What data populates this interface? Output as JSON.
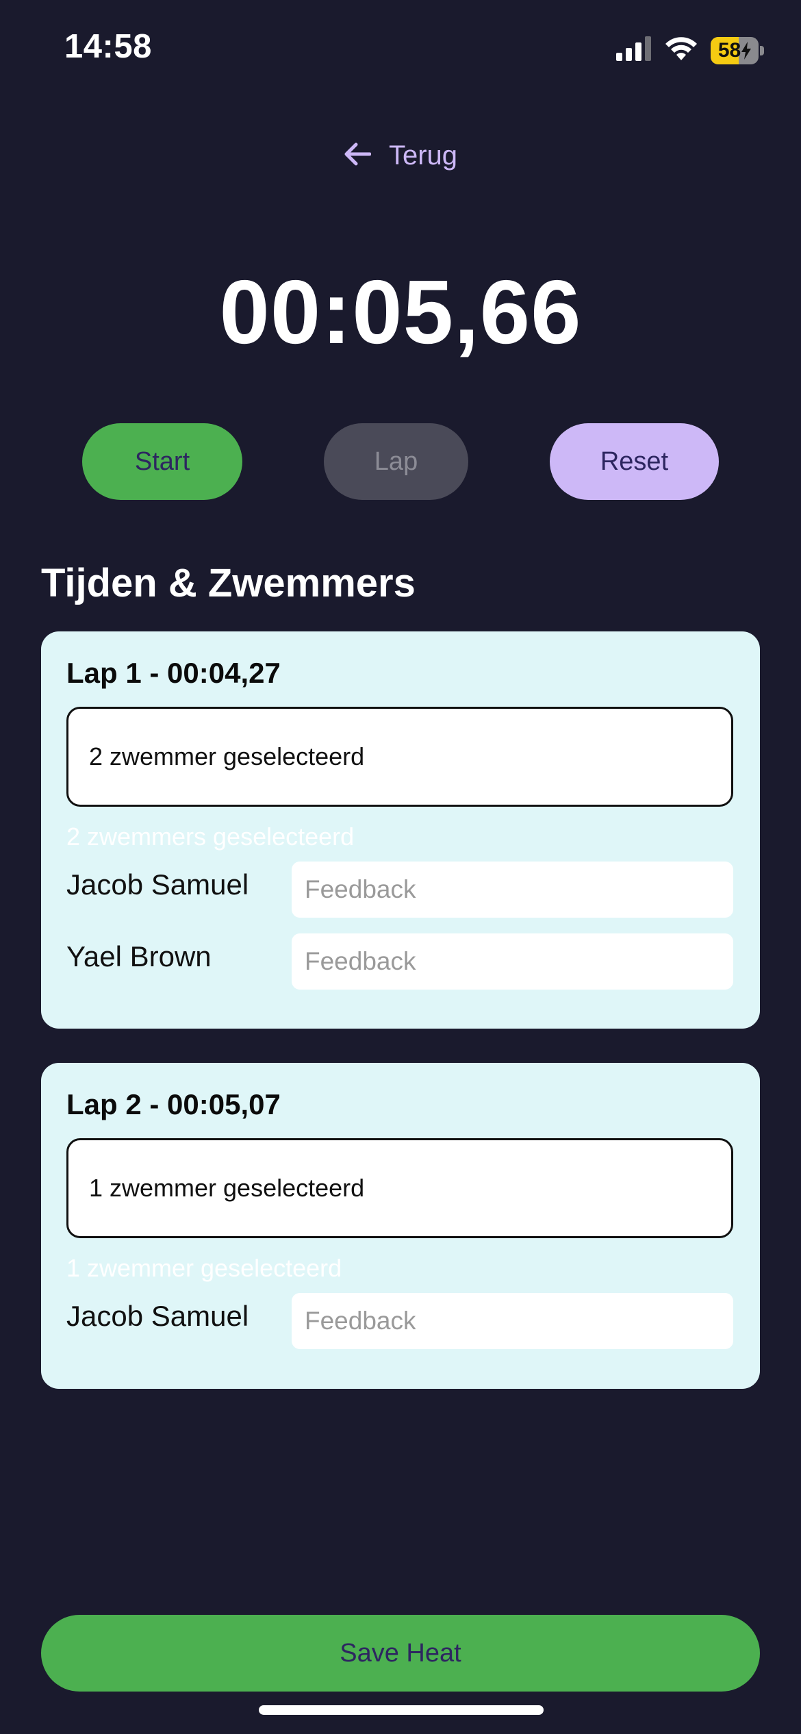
{
  "status_bar": {
    "time": "14:58",
    "battery_level": "58",
    "battery_fraction": 0.58,
    "icons": [
      "cellular-signal-icon",
      "wifi-icon",
      "battery-charging-icon"
    ]
  },
  "nav": {
    "back_label": "Terug",
    "back_icon": "arrow-left-icon"
  },
  "timer": {
    "display": "00:05,66"
  },
  "controls": {
    "start_label": "Start",
    "lap_label": "Lap",
    "reset_label": "Reset"
  },
  "section": {
    "title": "Tijden & Zwemmers"
  },
  "laps": [
    {
      "title": "Lap 1 - 00:04,27",
      "selection_text": "2 zwemmer geselecteerd",
      "count_text": "2 zwemmers geselecteerd",
      "swimmers": [
        {
          "name": "Jacob Samuel",
          "feedback_placeholder": "Feedback"
        },
        {
          "name": "Yael Brown",
          "feedback_placeholder": "Feedback"
        }
      ]
    },
    {
      "title": "Lap 2 - 00:05,07",
      "selection_text": "1 zwemmer geselecteerd",
      "count_text": "1 zwemmer geselecteerd",
      "swimmers": [
        {
          "name": "Jacob Samuel",
          "feedback_placeholder": "Feedback"
        }
      ]
    }
  ],
  "footer": {
    "save_label": "Save Heat"
  },
  "colors": {
    "background": "#1a1a2d",
    "accent_green": "#4cb050",
    "accent_purple": "#cdb8f7",
    "card_background": "#dff6f8",
    "disabled_button": "#4a4a58",
    "button_text": "#2d2660"
  }
}
